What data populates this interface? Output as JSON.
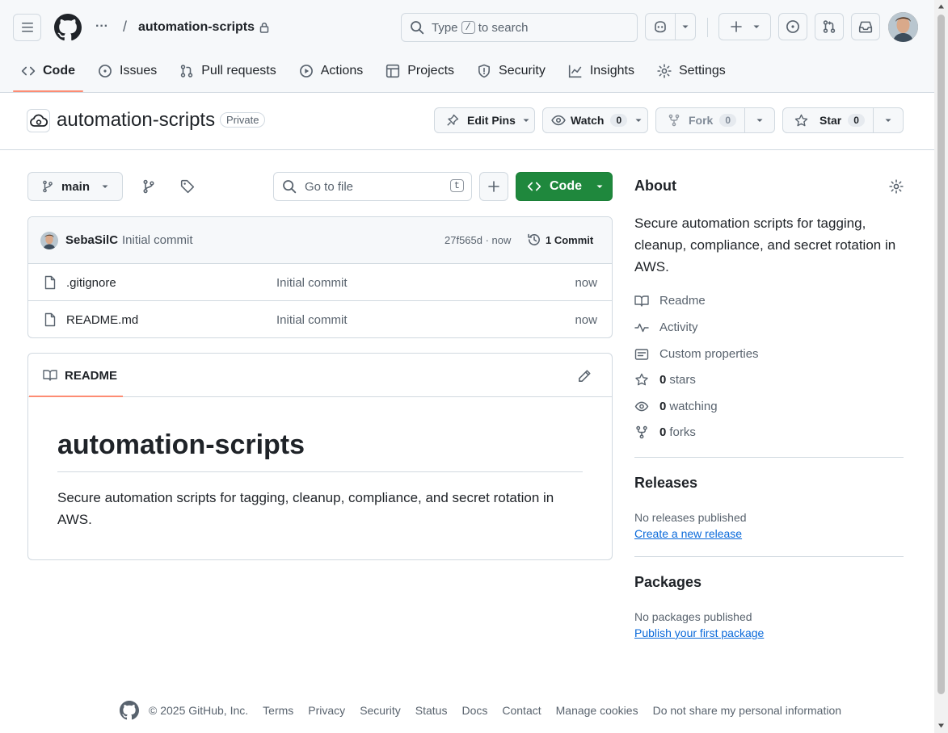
{
  "header": {
    "breadcrumb_more": "···",
    "separator": "/",
    "repo_name": "automation-scripts",
    "search": {
      "prefix": "Type",
      "key": "/",
      "suffix": "to search"
    }
  },
  "tabs": [
    {
      "label": "Code",
      "icon": "code-icon",
      "active": true
    },
    {
      "label": "Issues",
      "icon": "issue-icon"
    },
    {
      "label": "Pull requests",
      "icon": "pull-request-icon"
    },
    {
      "label": "Actions",
      "icon": "play-icon"
    },
    {
      "label": "Projects",
      "icon": "table-icon"
    },
    {
      "label": "Security",
      "icon": "shield-icon"
    },
    {
      "label": "Insights",
      "icon": "graph-icon"
    },
    {
      "label": "Settings",
      "icon": "gear-icon"
    }
  ],
  "repo": {
    "title": "automation-scripts",
    "visibility": "Private",
    "edit_pins": "Edit Pins",
    "watch": {
      "label": "Watch",
      "count": "0"
    },
    "fork": {
      "label": "Fork",
      "count": "0"
    },
    "star": {
      "label": "Star",
      "count": "0"
    }
  },
  "toolbar": {
    "branch": "main",
    "go_to_file": "Go to file",
    "go_to_file_key": "t",
    "code_button": "Code"
  },
  "commit": {
    "author": "SebaSilC",
    "message": "Initial commit",
    "hash_time": "27f565d · now",
    "count": "1 Commit"
  },
  "files": [
    {
      "name": ".gitignore",
      "message": "Initial commit",
      "time": "now"
    },
    {
      "name": "README.md",
      "message": "Initial commit",
      "time": "now"
    }
  ],
  "readme": {
    "tab_label": "README",
    "heading": "automation-scripts",
    "body": "Secure automation scripts for tagging, cleanup, compliance, and secret rotation in AWS."
  },
  "about": {
    "title": "About",
    "description": "Secure automation scripts for tagging, cleanup, compliance, and secret rotation in AWS.",
    "readme": "Readme",
    "activity": "Activity",
    "custom_properties": "Custom properties",
    "stars_count": "0",
    "stars_label": "stars",
    "watching_count": "0",
    "watching_label": "watching",
    "forks_count": "0",
    "forks_label": "forks"
  },
  "releases": {
    "title": "Releases",
    "empty": "No releases published",
    "link": "Create a new release"
  },
  "packages": {
    "title": "Packages",
    "empty": "No packages published",
    "link": "Publish your first package"
  },
  "footer": {
    "copyright": "© 2025 GitHub, Inc.",
    "links": [
      "Terms",
      "Privacy",
      "Security",
      "Status",
      "Docs",
      "Contact",
      "Manage cookies",
      "Do not share my personal information"
    ]
  },
  "colors": {
    "primary_button": "#1f883d",
    "tab_underline": "#fd8c73",
    "link": "#0969da"
  }
}
